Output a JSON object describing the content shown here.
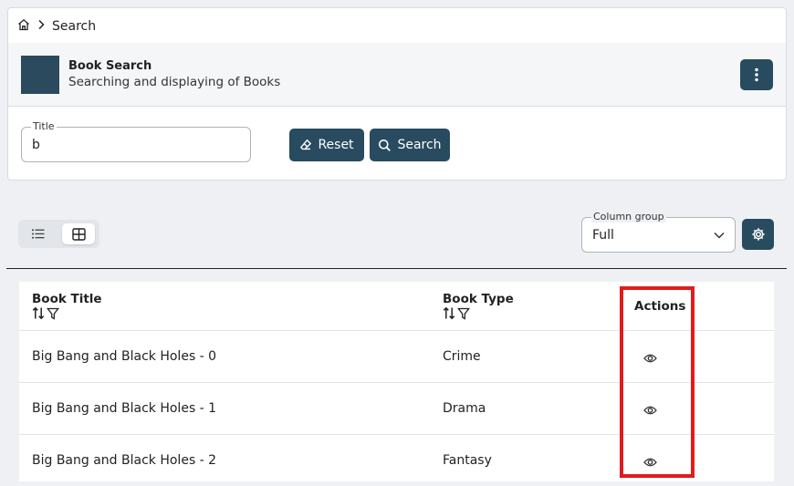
{
  "breadcrumb": {
    "home_icon": "home-icon",
    "separator_icon": "chevron-right-icon",
    "current": "Search"
  },
  "header": {
    "title": "Book Search",
    "subtitle": "Searching and displaying of Books",
    "menu_icon": "kebab-menu-icon"
  },
  "filters": {
    "title_label": "Title",
    "title_value": "b",
    "reset_label": "Reset",
    "search_label": "Search"
  },
  "toolbar": {
    "view_modes": [
      "list",
      "grid"
    ],
    "selected_view": "grid",
    "column_group_label": "Column group",
    "column_group_value": "Full"
  },
  "table": {
    "columns": [
      {
        "label": "Book Title",
        "sortable": true,
        "filterable": true
      },
      {
        "label": "Book Type",
        "sortable": true,
        "filterable": true
      },
      {
        "label": "Actions"
      }
    ],
    "rows": [
      {
        "title": "Big Bang and Black Holes - 0",
        "type": "Crime"
      },
      {
        "title": "Big Bang and Black Holes - 1",
        "type": "Drama"
      },
      {
        "title": "Big Bang and Black Holes - 2",
        "type": "Fantasy"
      }
    ]
  },
  "colors": {
    "primary": "#284b5f",
    "highlight": "#e01c1c"
  }
}
